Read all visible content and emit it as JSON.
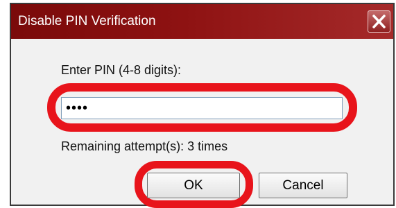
{
  "dialog": {
    "title": "Disable PIN Verification",
    "close_icon": "close-icon",
    "pin_label": "Enter PIN (4-8 digits):",
    "pin_value": "••••",
    "remaining_text": "Remaining attempt(s): 3 times",
    "ok_label": "OK",
    "cancel_label": "Cancel"
  },
  "colors": {
    "titlebar": "#8e1212",
    "highlight": "#e8141b",
    "dialog_background": "#f1f1f1"
  }
}
